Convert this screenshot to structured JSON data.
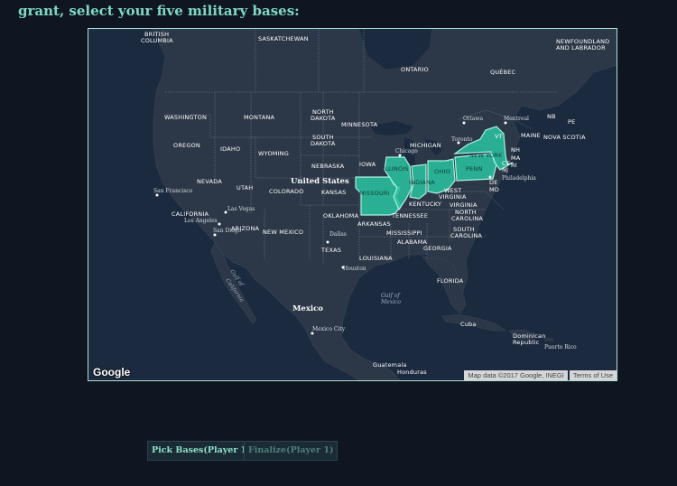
{
  "prompt": {
    "text": "grant, select your five military bases:"
  },
  "map": {
    "labels": {
      "british_columbia_1": "BRITISH",
      "british_columbia_2": "COLUMBIA",
      "saskatchewan": "SASKATCHEWAN",
      "newfoundland_1": "NEWFOUNDLAND",
      "newfoundland_2": "AND LABRADOR",
      "ontario": "ONTARIO",
      "quebec": "QUÉBEC",
      "washington": "WASHINGTON",
      "montana": "MONTANA",
      "north_dakota_1": "NORTH",
      "north_dakota_2": "DAKOTA",
      "minnesota": "MINNESOTA",
      "south_dakota_1": "SOUTH",
      "south_dakota_2": "DAKOTA",
      "oregon": "OREGON",
      "idaho": "IDAHO",
      "wyoming": "WYOMING",
      "nebraska": "NEBRASKA",
      "iowa": "IOWA",
      "michigan": "MICHIGAN",
      "nevada": "NEVADA",
      "utah": "UTAH",
      "colorado": "COLORADO",
      "kansas": "KANSAS",
      "united_states": "United States",
      "california": "CALIFORNIA",
      "arizona": "ARIZONA",
      "new_mexico": "NEW MEXICO",
      "oklahoma": "OKLAHOMA",
      "arkansas": "ARKANSAS",
      "tennessee": "TENNESSEE",
      "kentucky": "KENTUCKY",
      "west_virginia_1": "WEST",
      "west_virginia_2": "VIRGINIA",
      "virginia": "VIRGINIA",
      "north_carolina_1": "NORTH",
      "north_carolina_2": "CAROLINA",
      "south_carolina_1": "SOUTH",
      "south_carolina_2": "CAROLINA",
      "texas": "TEXAS",
      "louisiana": "LOUISIANA",
      "mississippi": "MISSISSIPPI",
      "alabama": "ALABAMA",
      "georgia": "GEORGIA",
      "florida": "FLORIDA",
      "nb": "NB",
      "pe": "PE",
      "maine": "MAINE",
      "nova_scotia": "NOVA SCOTIA",
      "vt": "VT",
      "nh": "NH",
      "ma": "MA",
      "ct": "CT",
      "ri": "RI",
      "nj": "NJ",
      "de": "DE",
      "md": "MD",
      "mexico": "Mexico",
      "cuba": "Cuba",
      "dominican_1": "Dominican",
      "dominican_2": "Republic",
      "guatemala": "Guatemala",
      "honduras": "Honduras",
      "gulf_of_california_1": "Gulf of",
      "gulf_of_california_2": "California",
      "gulf_of_mexico_1": "Gulf of",
      "gulf_of_mexico_2": "Mexico"
    },
    "cities": {
      "ottawa": "Ottawa",
      "montreal": "Montreal",
      "toronto": "Toronto",
      "chicago": "Chicago",
      "philadelphia": "Philadelphia",
      "san_francisco": "San Francisco",
      "las_vegas": "Las Vegas",
      "los_angeles": "Los Angeles",
      "san_diego": "San Diego",
      "dallas": "Dallas",
      "houston": "Houston",
      "mexico_city": "Mexico City",
      "puerto_rico": "Puerto Rico"
    },
    "selected_states": [
      {
        "id": "missouri",
        "label": "MISSOURI"
      },
      {
        "id": "illinois",
        "label": "ILLINOIS"
      },
      {
        "id": "indiana",
        "label": "INDIANA"
      },
      {
        "id": "ohio",
        "label": "OHIO"
      },
      {
        "id": "pennsylvania",
        "label": "PENN"
      },
      {
        "id": "new_york",
        "label": "NEW YORK"
      }
    ],
    "google_logo": "Google",
    "map_data": "Map data ©2017 Google, INEGI",
    "terms": "Terms of Use",
    "colors": {
      "selection_fill": "#2ac4a2",
      "selection_stroke": "#a9f2df",
      "land": "#2b3647",
      "water": "#1c2a3f"
    }
  },
  "buttons": {
    "pick_bases": "Pick Bases(Player 1)",
    "finalize": "Finalize(Player 1)"
  }
}
